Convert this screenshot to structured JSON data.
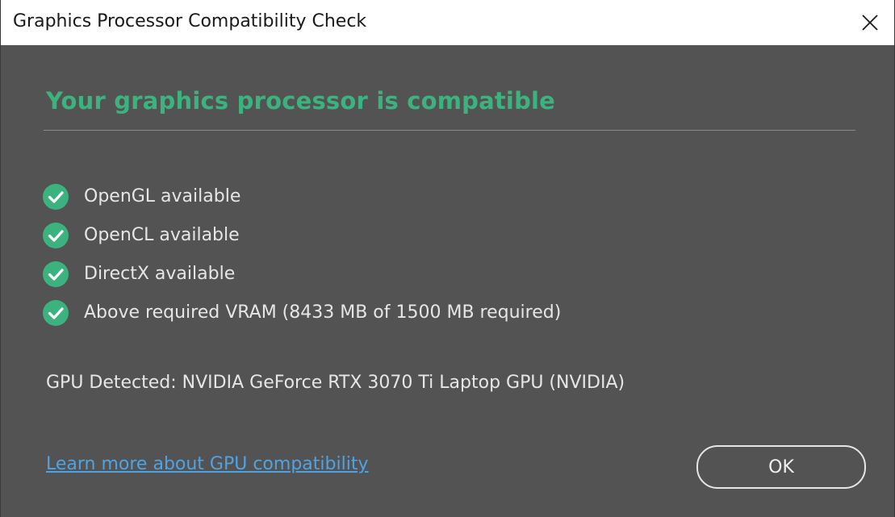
{
  "window": {
    "title": "Graphics Processor Compatibility Check",
    "close_icon": "close-icon"
  },
  "main": {
    "heading": "Your graphics processor is compatible",
    "checks": [
      {
        "label": "OpenGL available",
        "icon": "check-circle-icon"
      },
      {
        "label": "OpenCL available",
        "icon": "check-circle-icon"
      },
      {
        "label": "DirectX available",
        "icon": "check-circle-icon"
      },
      {
        "label": "Above required VRAM (8433 MB of 1500 MB required)",
        "icon": "check-circle-icon"
      }
    ],
    "gpu_detected": "GPU Detected: NVIDIA GeForce RTX 3070 Ti Laptop GPU (NVIDIA)",
    "learn_more_link": "Learn more about GPU compatibility",
    "ok_label": "OK"
  },
  "colors": {
    "accent_green": "#3cb37f",
    "link_blue": "#4fa3e3",
    "background": "#535353",
    "titlebar": "#ffffff"
  }
}
